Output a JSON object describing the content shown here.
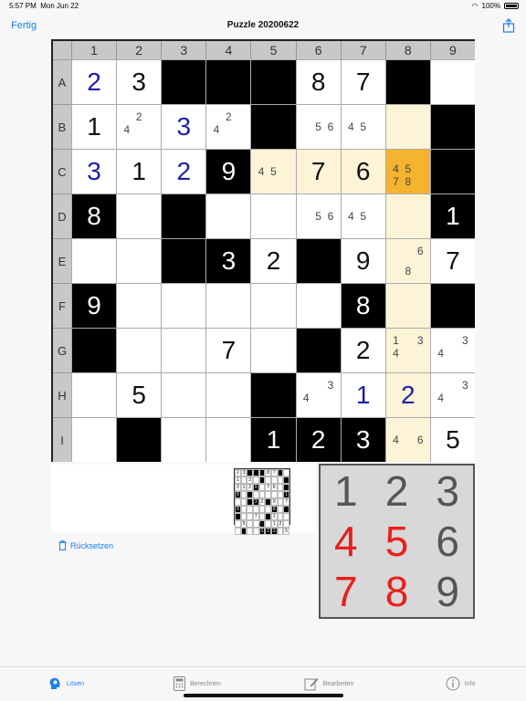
{
  "status": {
    "time": "5:57 PM",
    "date": "Mon Jun 22",
    "battery": "100%"
  },
  "nav": {
    "done_label": "Fertig",
    "title": "Puzzle 20200622"
  },
  "columns": [
    "1",
    "2",
    "3",
    "4",
    "5",
    "6",
    "7",
    "8",
    "9"
  ],
  "rows": [
    "A",
    "B",
    "C",
    "D",
    "E",
    "F",
    "G",
    "H",
    "I"
  ],
  "cells": [
    [
      {
        "v": "2",
        "c": "blue"
      },
      {
        "v": "3"
      },
      {
        "k": "black"
      },
      {
        "k": "black"
      },
      {
        "k": "black"
      },
      {
        "v": "8"
      },
      {
        "v": "7"
      },
      {
        "k": "black"
      },
      {}
    ],
    [
      {
        "v": "1"
      },
      {
        "cand": [
          "",
          "2",
          "",
          "4",
          "",
          "",
          "",
          "",
          ""
        ]
      },
      {
        "v": "3",
        "c": "blue"
      },
      {
        "cand": [
          "",
          "2",
          "",
          "4",
          "",
          "",
          "",
          "",
          ""
        ]
      },
      {
        "k": "black"
      },
      {
        "cand": [
          "",
          "",
          "",
          "",
          "5",
          "6",
          "",
          "",
          ""
        ]
      },
      {
        "cand": [
          "",
          "",
          "",
          "4",
          "5",
          "",
          "",
          "",
          ""
        ]
      },
      {
        "k": "hl"
      },
      {
        "k": "black"
      }
    ],
    [
      {
        "v": "3",
        "c": "blue"
      },
      {
        "v": "1"
      },
      {
        "v": "2",
        "c": "blue"
      },
      {
        "v": "9",
        "k": "black"
      },
      {
        "k": "hl",
        "cand": [
          "",
          "",
          "",
          "4",
          "5",
          "",
          "",
          "",
          ""
        ]
      },
      {
        "v": "7",
        "k": "hl"
      },
      {
        "v": "6",
        "k": "hl"
      },
      {
        "k": "sel",
        "cand": [
          "",
          "",
          "",
          "4",
          "5",
          "",
          "7",
          "8",
          ""
        ]
      },
      {
        "k": "black"
      }
    ],
    [
      {
        "v": "8",
        "k": "black"
      },
      {},
      {
        "k": "black"
      },
      {},
      {},
      {
        "cand": [
          "",
          "",
          "",
          "",
          "5",
          "6",
          "",
          "",
          ""
        ]
      },
      {
        "cand": [
          "",
          "",
          "",
          "4",
          "5",
          "",
          "",
          "",
          ""
        ]
      },
      {
        "k": "hl"
      },
      {
        "v": "1",
        "k": "black"
      }
    ],
    [
      {},
      {},
      {
        "k": "black"
      },
      {
        "v": "3",
        "k": "black"
      },
      {
        "v": "2"
      },
      {
        "k": "black"
      },
      {
        "v": "9"
      },
      {
        "k": "hl",
        "cand": [
          "",
          "",
          "6",
          "",
          "",
          "",
          "",
          "8",
          ""
        ]
      },
      {
        "v": "7"
      }
    ],
    [
      {
        "v": "9",
        "k": "black"
      },
      {},
      {},
      {},
      {},
      {},
      {
        "v": "8",
        "k": "black"
      },
      {
        "k": "hl"
      },
      {
        "k": "black"
      }
    ],
    [
      {
        "k": "black"
      },
      {},
      {},
      {
        "v": "7"
      },
      {},
      {
        "k": "black"
      },
      {
        "v": "2"
      },
      {
        "k": "hl",
        "cand": [
          "1",
          "",
          "3",
          "4",
          "",
          "",
          "",
          "",
          ""
        ]
      },
      {
        "cand": [
          "",
          "",
          "3",
          "4",
          "",
          "",
          "",
          "",
          ""
        ]
      }
    ],
    [
      {},
      {
        "v": "5"
      },
      {},
      {},
      {
        "k": "black"
      },
      {
        "cand": [
          "",
          "",
          "3",
          "4",
          "",
          "",
          "",
          "",
          ""
        ]
      },
      {
        "v": "1",
        "c": "blue"
      },
      {
        "v": "2",
        "c": "blue",
        "k": "hl"
      },
      {
        "cand": [
          "",
          "",
          "3",
          "4",
          "",
          "",
          "",
          "",
          ""
        ]
      }
    ],
    [
      {},
      {
        "k": "black"
      },
      {},
      {},
      {
        "v": "1",
        "k": "black"
      },
      {
        "v": "2",
        "k": "black"
      },
      {
        "v": "3",
        "k": "black"
      },
      {
        "k": "hl",
        "cand": [
          "",
          "",
          "",
          "4",
          "",
          "6",
          "",
          "",
          ""
        ]
      },
      {
        "v": "5"
      }
    ]
  ],
  "preview": {
    "count": "0"
  },
  "keypad": [
    {
      "label": "1",
      "color": "gray"
    },
    {
      "label": "2",
      "color": "gray"
    },
    {
      "label": "3",
      "color": "gray"
    },
    {
      "label": "4",
      "color": "red"
    },
    {
      "label": "5",
      "color": "red"
    },
    {
      "label": "6",
      "color": "gray"
    },
    {
      "label": "7",
      "color": "red"
    },
    {
      "label": "8",
      "color": "red"
    },
    {
      "label": "9",
      "color": "gray"
    }
  ],
  "reset_label": "Rücksetzen",
  "tabs": [
    {
      "label": "Lösen",
      "icon": "head-bulb-icon",
      "active": true
    },
    {
      "label": "Berechnen",
      "icon": "calculator-icon",
      "active": false
    },
    {
      "label": "Bearbeiten",
      "icon": "edit-icon",
      "active": false
    },
    {
      "label": "Info",
      "icon": "info-icon",
      "active": false
    }
  ],
  "colors": {
    "accent": "#1a7ff2",
    "highlight": "#fdf4d8",
    "selected": "#f5b430",
    "given_blue": "#1d1daa",
    "key_red": "#e8201c"
  }
}
